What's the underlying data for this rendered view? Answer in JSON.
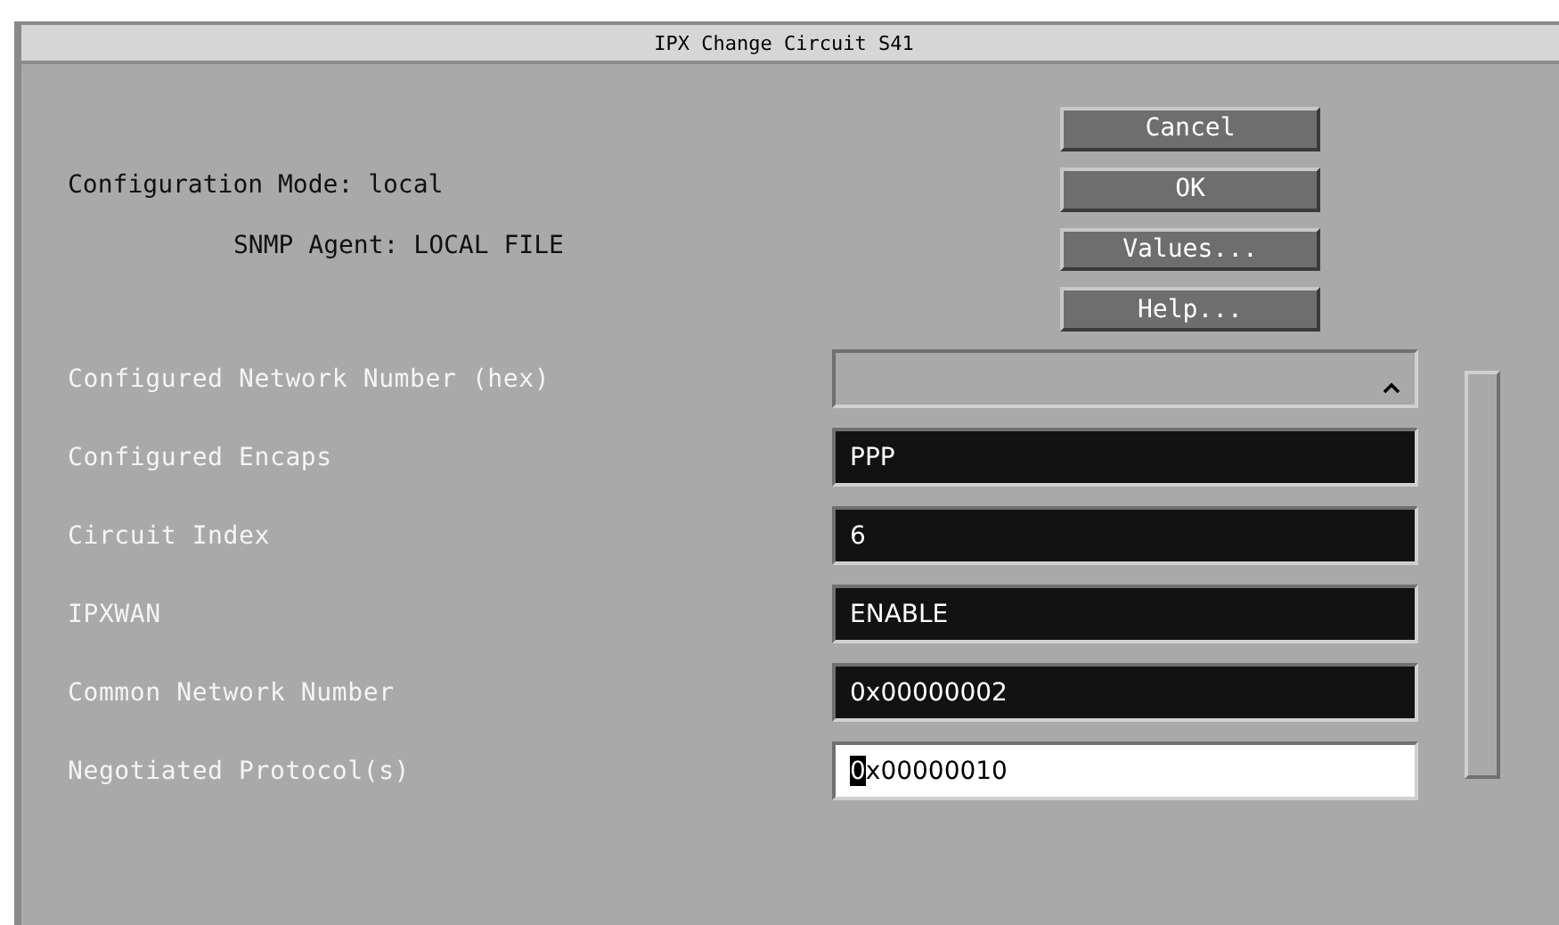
{
  "window": {
    "title": "IPX Change Circuit S41"
  },
  "info": [
    {
      "label": "Configuration Mode: local",
      "indent": false
    },
    {
      "label": "SNMP Agent: LOCAL FILE",
      "indent": true
    }
  ],
  "buttons": [
    "Cancel",
    "OK",
    "Values...",
    "Help..."
  ],
  "fields": [
    {
      "label": "Configured Network Number (hex)",
      "kind": "dropdown"
    },
    {
      "label": "Configured Encaps",
      "kind": "readonly",
      "value": "PPP"
    },
    {
      "label": "Circuit Index",
      "kind": "readonly",
      "value": "6"
    },
    {
      "label": "IPXWAN",
      "kind": "readonly",
      "value": "ENABLE"
    },
    {
      "label": "Common Network Number",
      "kind": "readonly",
      "value": "0x00000002"
    },
    {
      "label": "Negotiated Protocol(s)",
      "kind": "editable",
      "value": "0x00000010",
      "focused": true
    }
  ]
}
